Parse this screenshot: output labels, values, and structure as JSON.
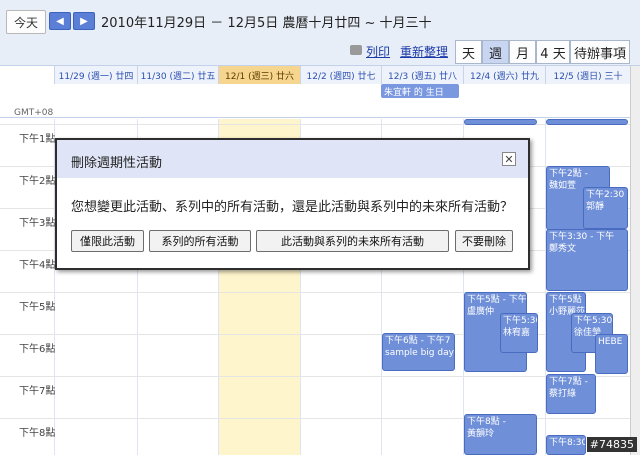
{
  "toolbar": {
    "today_label": "今天",
    "prev_icon": "◀",
    "next_icon": "▶",
    "date_range": "2010年11月29日 － 12月5日 農曆十月廿四 ~ 十月三十",
    "print_label": "列印",
    "refresh_label": "重新整理"
  },
  "views": [
    {
      "label": "天"
    },
    {
      "label": "週"
    },
    {
      "label": "月"
    },
    {
      "label": "4 天"
    },
    {
      "label": "待辦事項"
    }
  ],
  "days": [
    {
      "label": "11/29 (週一) 廿四"
    },
    {
      "label": "11/30 (週二) 廿五"
    },
    {
      "label": "12/1 (週三) 廿六"
    },
    {
      "label": "12/2 (週四) 廿七"
    },
    {
      "label": "12/3 (週五) 廿八"
    },
    {
      "label": "12/4 (週六) 廿九"
    },
    {
      "label": "12/5 (週日) 三十"
    }
  ],
  "timezone_label": "GMT+08",
  "hours": [
    "下午1點",
    "下午2點",
    "下午3點",
    "下午4點",
    "下午5點",
    "下午6點",
    "下午7點",
    "下午8點"
  ],
  "allday_event": "朱宜軒 的 生日",
  "events": [
    {
      "text": "下午5點 - 下午"
    },
    {
      "text": "盧廣仲"
    },
    {
      "text": "下午5:30"
    },
    {
      "text": "林宥嘉"
    },
    {
      "text": "下午6點 - 下午7"
    },
    {
      "text": "sample big day"
    },
    {
      "text": "下午2點 -"
    },
    {
      "text": "魏如萱"
    },
    {
      "text": "下午2:30"
    },
    {
      "text": "郭靜"
    },
    {
      "text": "下午3:30 - 下午"
    },
    {
      "text": "鄭秀文"
    },
    {
      "text": "下午5點 - 下"
    },
    {
      "text": "小野麗莎"
    },
    {
      "text": "下午5:30"
    },
    {
      "text": "徐佳瑩"
    },
    {
      "text": "HEBE"
    },
    {
      "text": "下午7點 -"
    },
    {
      "text": "蔡打綠"
    },
    {
      "text": "下午8點 -"
    },
    {
      "text": "黃韻玲"
    },
    {
      "text": "下午8:30"
    }
  ],
  "dialog": {
    "title": "刪除週期性活動",
    "close_icon": "✕",
    "message": "您想變更此活動、系列中的所有活動，還是此活動與系列中的未來所有活動？",
    "buttons": [
      "僅限此活動",
      "系列的所有活動",
      "此活動與系列的未來所有活動",
      "不要刪除"
    ]
  },
  "watermark": "#74835"
}
